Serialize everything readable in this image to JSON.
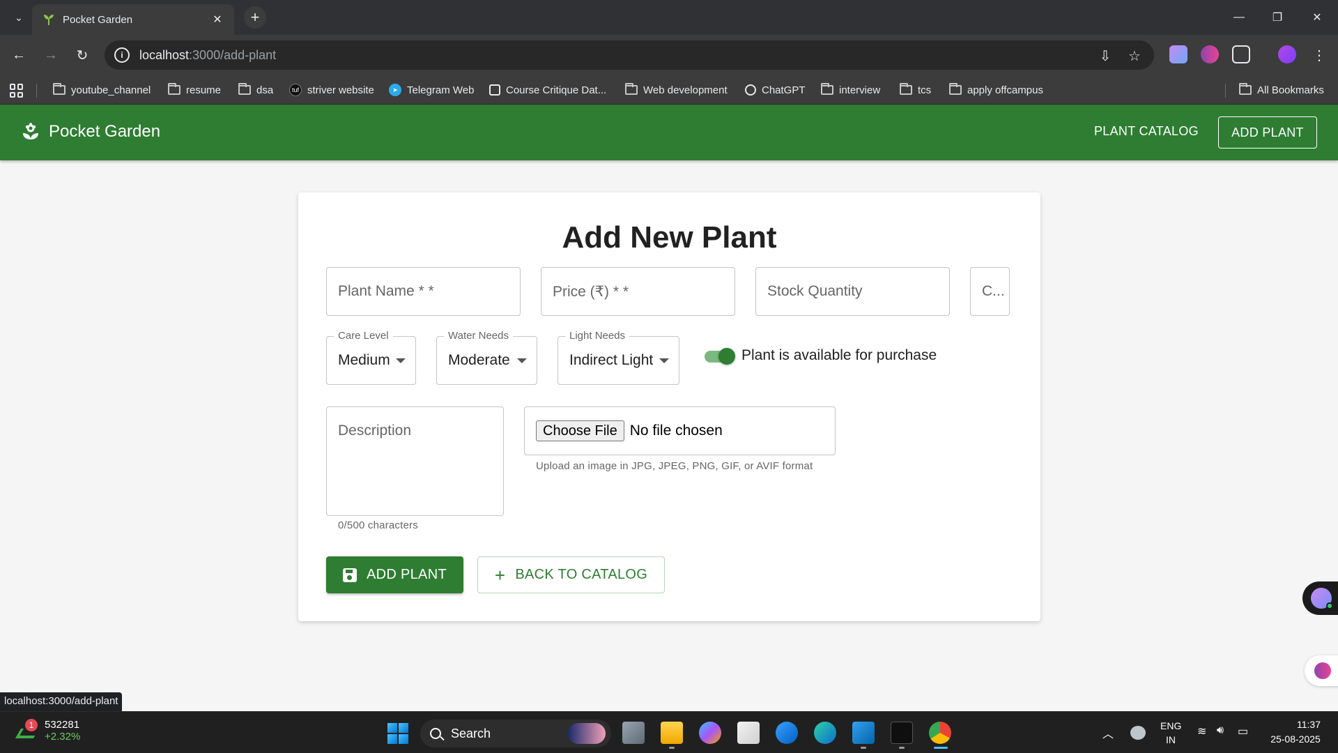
{
  "browser": {
    "tab_title": "Pocket Garden",
    "url_host": "localhost",
    "url_path": ":3000/add-plant",
    "bookmarks": [
      "youtube_channel",
      "resume",
      "dsa",
      "striver website",
      "Telegram Web",
      "Course Critique Dat...",
      "Web development",
      "ChatGPT",
      "interview",
      "tcs",
      "apply offcampus"
    ],
    "all_bookmarks": "All Bookmarks",
    "status_url": "localhost:3000/add-plant"
  },
  "app": {
    "brand": "Pocket Garden",
    "nav_catalog": "PLANT CATALOG",
    "nav_add": "ADD PLANT",
    "accent_color": "#2e7d32"
  },
  "form": {
    "title": "Add New Plant",
    "plant_name_placeholder": "Plant Name * *",
    "price_placeholder": "Price (₹) * *",
    "stock_placeholder": "Stock Quantity",
    "category_truncated": "C...",
    "care_level": {
      "label": "Care Level",
      "value": "Medium"
    },
    "water_needs": {
      "label": "Water Needs",
      "value": "Moderate"
    },
    "light_needs": {
      "label": "Light Needs",
      "value": "Indirect Light"
    },
    "available_switch": {
      "label": "Plant is available for purchase",
      "checked": true
    },
    "description_placeholder": "Description",
    "char_counter": "0/500 characters",
    "file_button": "Choose File",
    "file_status": "No file chosen",
    "file_helper": "Upload an image in JPG, JPEG, PNG, GIF, or AVIF format",
    "submit_label": "ADD PLANT",
    "back_label": "BACK TO CATALOG"
  },
  "taskbar": {
    "stock_value": "532281",
    "stock_change": "+2.32%",
    "stock_badge": "1",
    "search_label": "Search",
    "lang_top": "ENG",
    "lang_bottom": "IN",
    "time": "11:37",
    "date": "25-08-2025"
  }
}
